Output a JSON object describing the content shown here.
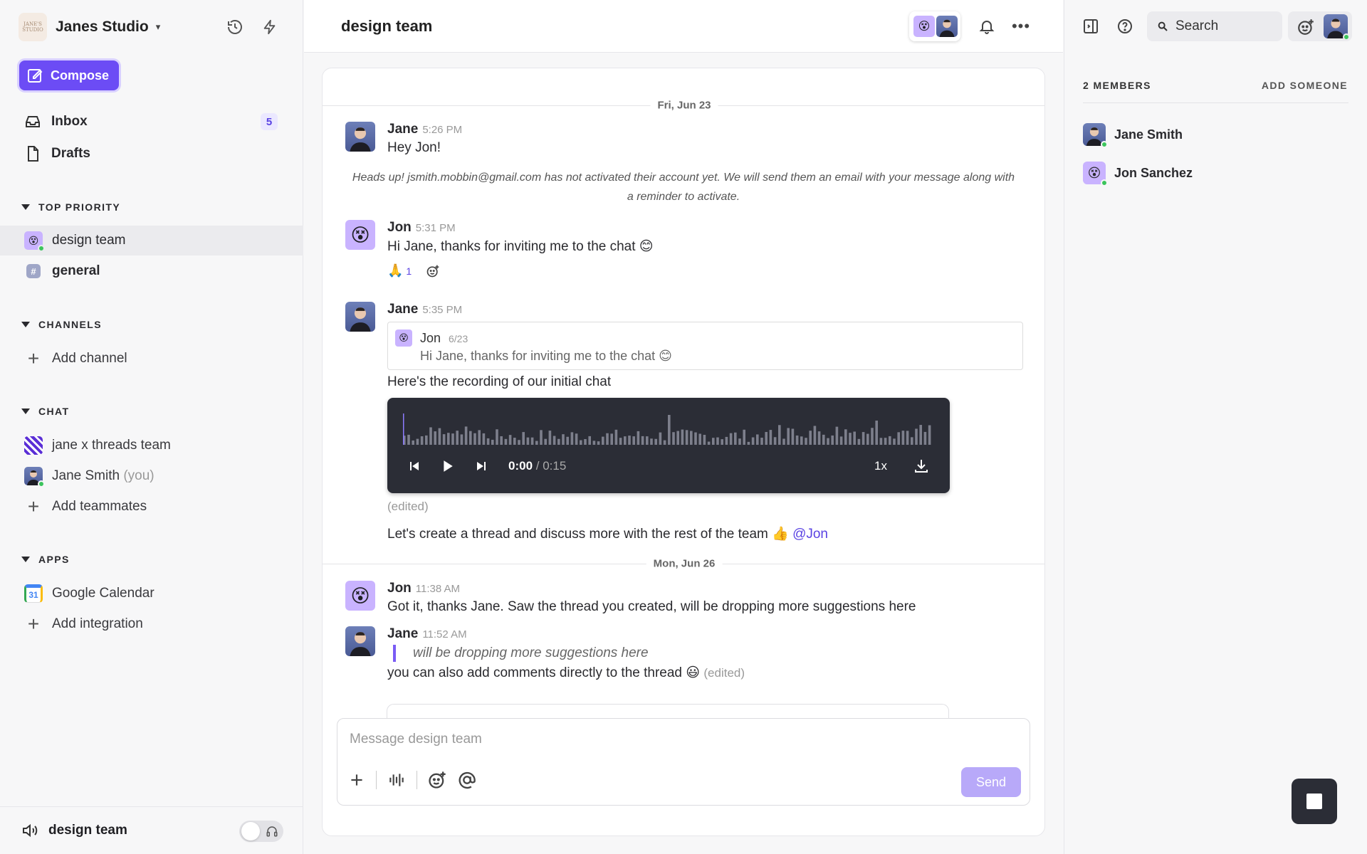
{
  "workspace": {
    "name": "Janes Studio",
    "logo_text": "JANE'S STUDIO"
  },
  "sidebar": {
    "compose_label": "Compose",
    "inbox_label": "Inbox",
    "inbox_count": "5",
    "drafts_label": "Drafts",
    "sections": {
      "top_priority": "TOP PRIORITY",
      "channels": "CHANNELS",
      "chat": "CHAT",
      "apps": "APPS"
    },
    "top_priority_items": [
      "design team",
      "general"
    ],
    "add_channel": "Add channel",
    "chat_items": [
      "jane x threads team",
      "Jane Smith"
    ],
    "you_label": "(you)",
    "add_teammates": "Add teammates",
    "apps_items": [
      "Google Calendar"
    ],
    "add_integration": "Add integration",
    "calendar_day": "31",
    "footer_channel": "design team"
  },
  "header": {
    "title": "design team"
  },
  "right": {
    "search_placeholder": "Search",
    "members_title": "2 MEMBERS",
    "add_someone": "ADD SOMEONE",
    "members": [
      "Jane Smith",
      "Jon Sanchez"
    ]
  },
  "chat": {
    "day1": "Fri, Jun 23",
    "day2": "Mon, Jun 26",
    "m1": {
      "name": "Jane",
      "time": "5:26 PM",
      "text": "Hey Jon!"
    },
    "notice": "Heads up! jsmith.mobbin@gmail.com has not activated their account yet. We will send them an email with your message along with a reminder to activate.",
    "m2": {
      "name": "Jon",
      "time": "5:31 PM",
      "text": "Hi Jane, thanks for inviting me to the chat 😊",
      "reaction": "🙏",
      "reaction_count": "1"
    },
    "m3": {
      "name": "Jane",
      "time": "5:35 PM",
      "quote_name": "Jon",
      "quote_date": "6/23",
      "quote_text": "Hi Jane, thanks for inviting me to the chat 😊",
      "text": "Here's the recording of our initial chat",
      "player_time": "0:00",
      "player_total": "/ 0:15",
      "player_rate": "1x",
      "player_progress": 0,
      "edited": "(edited)",
      "followup": "Let's create a thread and discuss more with the rest of the team 👍",
      "mention": "@Jon"
    },
    "m4": {
      "name": "Jon",
      "time": "11:38 AM",
      "text": "Got it, thanks Jane. Saw the thread you created, will be dropping more suggestions here"
    },
    "m5": {
      "name": "Jane",
      "time": "11:52 AM",
      "quote": "will be dropping more suggestions here",
      "text": "you can also add comments directly to the thread 😃",
      "edited": "(edited)"
    }
  },
  "composer": {
    "placeholder": "Message design team",
    "send_label": "Send"
  }
}
